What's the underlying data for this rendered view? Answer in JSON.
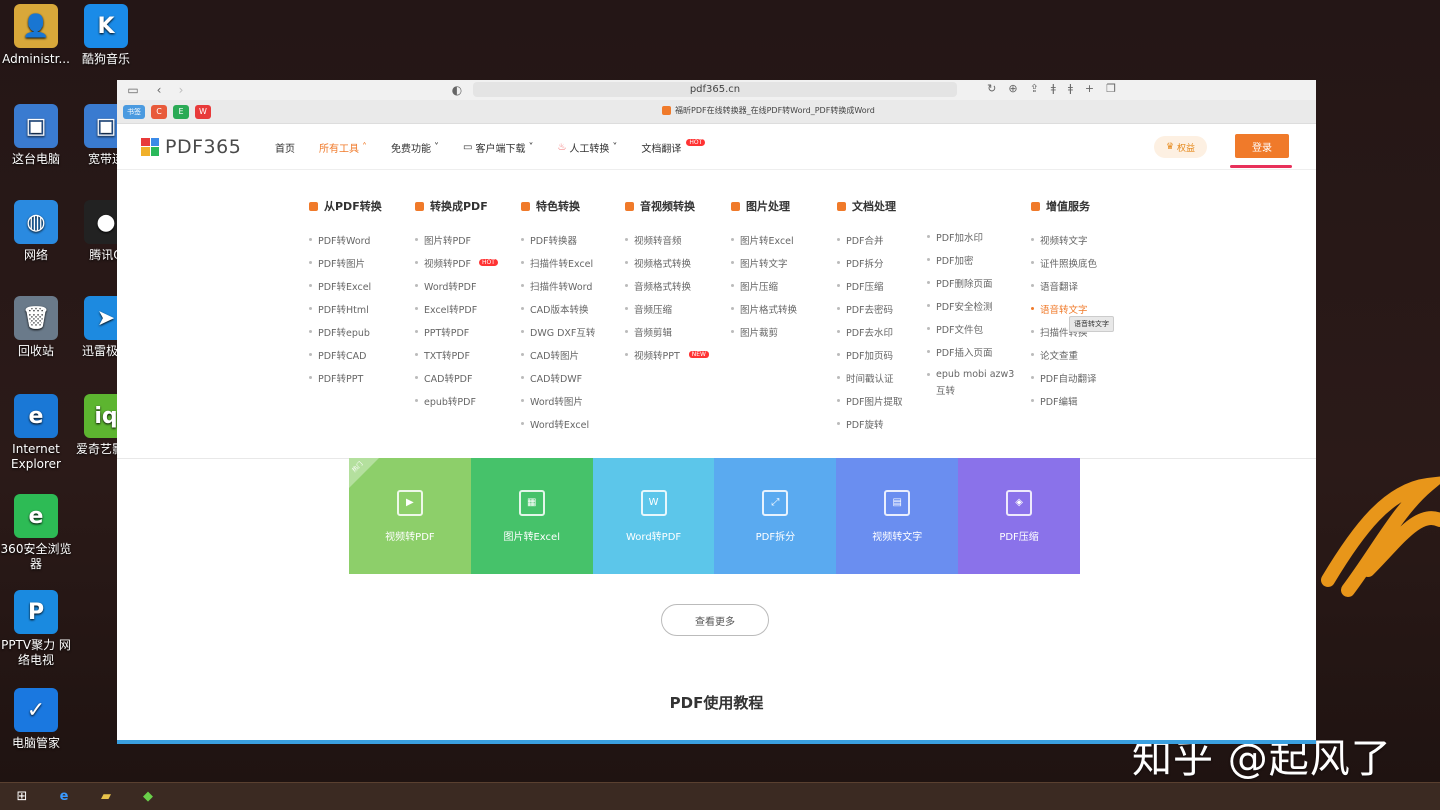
{
  "desktop": {
    "icons": [
      {
        "label": "Administr...",
        "color": "#d8a83a",
        "glyph": "👤"
      },
      {
        "label": "酷狗音乐",
        "color": "#1a8be8",
        "glyph": "K"
      },
      {
        "label": "这台电脑",
        "color": "#3a7bd0",
        "glyph": "▣"
      },
      {
        "label": "宽带连",
        "color": "#3a7bd0",
        "glyph": "▣"
      },
      {
        "label": "网络",
        "color": "#2a8ae0",
        "glyph": "◍"
      },
      {
        "label": "腾讯Q",
        "color": "#222",
        "glyph": "●"
      },
      {
        "label": "回收站",
        "color": "#6a7a8a",
        "glyph": "🗑"
      },
      {
        "label": "迅雷极速",
        "color": "#1d8ae0",
        "glyph": "➤"
      },
      {
        "label": "Internet Explorer",
        "color": "#1a78d6",
        "glyph": "e"
      },
      {
        "label": "爱奇艺影音",
        "color": "#5db530",
        "glyph": "iq"
      },
      {
        "label": "360安全浏览器",
        "color": "#2dbb55",
        "glyph": "e"
      },
      {
        "label": "PPTV聚力 网络电视",
        "color": "#1a8ae0",
        "glyph": "P"
      },
      {
        "label": "电脑管家",
        "color": "#1a78e0",
        "glyph": "✓"
      }
    ],
    "watermark": "知乎 @起风了"
  },
  "browser": {
    "address": "pdf365.cn",
    "tab_title": "福昕PDF在线转换器_在线PDF转Word_PDF转换成Word",
    "tab_favicons": [
      {
        "label": "书签",
        "color": "#4a9ae0"
      },
      {
        "label": "C",
        "color": "#e85a3a"
      },
      {
        "label": "E",
        "color": "#2aaa55"
      },
      {
        "label": "W",
        "color": "#e83a3a"
      }
    ]
  },
  "site": {
    "logo": "PDF365",
    "nav": [
      "首页",
      "所有工具",
      "免费功能",
      "客户端下载",
      "人工转换",
      "文档翻译"
    ],
    "hot_badge": "HOT",
    "new_badge": "NEW",
    "quanyi": "权益",
    "login": "登录"
  },
  "menu": {
    "columns": [
      {
        "title": "从PDF转换",
        "items": [
          "PDF转Word",
          "PDF转图片",
          "PDF转Excel",
          "PDF转Html",
          "PDF转epub",
          "PDF转CAD",
          "PDF转PPT"
        ]
      },
      {
        "title": "转换成PDF",
        "items": [
          "图片转PDF",
          "视频转PDF",
          "Word转PDF",
          "Excel转PDF",
          "PPT转PDF",
          "TXT转PDF",
          "CAD转PDF",
          "epub转PDF"
        ]
      },
      {
        "title": "特色转换",
        "items": [
          "PDF转换器",
          "扫描件转Excel",
          "扫描件转Word",
          "CAD版本转换",
          "DWG DXF互转",
          "CAD转图片",
          "CAD转DWF",
          "Word转图片",
          "Word转Excel"
        ]
      },
      {
        "title": "音视频转换",
        "items": [
          "视频转音频",
          "视频格式转换",
          "音频格式转换",
          "音频压缩",
          "音频剪辑",
          "视频转PPT"
        ]
      },
      {
        "title": "图片处理",
        "items": [
          "图片转Excel",
          "图片转文字",
          "图片压缩",
          "图片格式转换",
          "图片裁剪"
        ]
      },
      {
        "title": "文档处理",
        "items": [
          "PDF合并",
          "PDF拆分",
          "PDF压缩",
          "PDF去密码",
          "PDF去水印",
          "PDF加页码",
          "时间戳认证",
          "PDF图片提取",
          "PDF旋转"
        ]
      },
      {
        "title": "",
        "items": [
          "PDF加水印",
          "PDF加密",
          "PDF删除页面",
          "PDF安全检测",
          "PDF文件包",
          "PDF插入页面",
          "epub mobi azw3",
          "互转"
        ]
      },
      {
        "title": "增值服务",
        "items": [
          "视频转文字",
          "证件照换底色",
          "语音翻译",
          "语音转文字",
          "扫描件转换",
          "论文查重",
          "PDF自动翻译",
          "PDF编辑"
        ]
      }
    ],
    "tooltip": "语音转文字"
  },
  "tiles": [
    {
      "label": "视频转PDF",
      "color": "#8dcf6a",
      "badge": "热门"
    },
    {
      "label": "图片转Excel",
      "color": "#46c26a"
    },
    {
      "label": "Word转PDF",
      "color": "#5cc6ea"
    },
    {
      "label": "PDF拆分",
      "color": "#5aaaf0"
    },
    {
      "label": "视频转文字",
      "color": "#6a8ef0"
    },
    {
      "label": "PDF压缩",
      "color": "#8a72ea"
    }
  ],
  "more_button": "查看更多",
  "tutorial_title": "PDF使用教程"
}
